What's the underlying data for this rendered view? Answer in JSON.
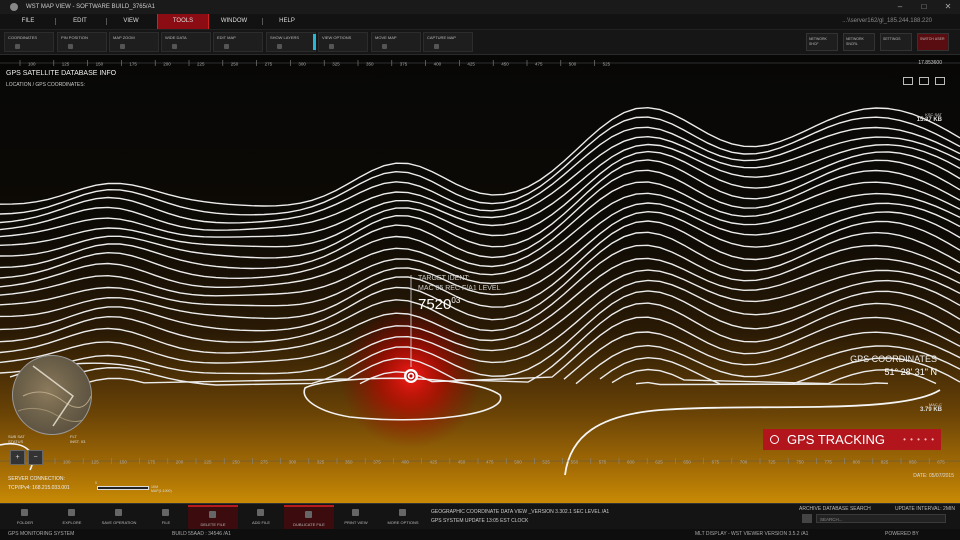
{
  "window": {
    "title": "WST MAP VIEW - SOFTWARE BUILD_3765/A1",
    "controls": [
      "–",
      "□",
      "✕"
    ]
  },
  "menu": {
    "items": [
      "FILE",
      "EDIT",
      "VIEW",
      "TOOLS",
      "WINDOW",
      "HELP"
    ],
    "active": "TOOLS",
    "ip": "...\\\\server162/gl_185.244.188.220"
  },
  "toolbar": {
    "buttons": [
      "COORDINATES",
      "PIN POSITION",
      "MAP ZOOM",
      "WIDE DATA",
      "EDIT MAP",
      "SHOW LAYERS",
      "VIEW OPTIONS",
      "MOVE MAP",
      "CAPTURE MAP"
    ],
    "right_buttons": [
      "NETWORK SHCF",
      "NETWORK SNCRL",
      "SETTINGS",
      "SWITCH USER"
    ]
  },
  "map": {
    "panel_title": "GPS SATELLITE DATABASE INFO",
    "panel_subtitle": "LOCATION / GPS COORDINATES:",
    "ruler_top": [
      "100",
      "125",
      "150",
      "175",
      "200",
      "225",
      "250",
      "275",
      "300",
      "325",
      "350",
      "375",
      "400",
      "425",
      "450",
      "475",
      "500",
      "525"
    ],
    "ruler_bottom": [
      "100",
      "125",
      "150",
      "175",
      "200",
      "225",
      "250",
      "275",
      "300",
      "325",
      "350",
      "375",
      "400",
      "425",
      "450",
      "475",
      "500",
      "525",
      "550",
      "575",
      "600",
      "625",
      "650",
      "675",
      "700",
      "725",
      "750",
      "775",
      "800",
      "825",
      "850",
      "875"
    ],
    "sat_readout": "17.853600",
    "ksc": {
      "label": "KSC SAT",
      "value": "15.37 KB"
    },
    "mac": {
      "label": "MAC-C",
      "value": "3.79 KB"
    },
    "target": {
      "line1": "TARGET IDENT:",
      "line2": "MAC 05 REC F/A1 LEVEL",
      "value": "7520",
      "value_sup": "03"
    },
    "gps_coordinates_label": "GPS COORDINATES",
    "gps_coordinates_value": "51° 28' 31\" N",
    "tracking_label": "GPS TRACKING",
    "tracking_dots": "• • • • •",
    "date": "DATE: 05/07/2015",
    "server_label": "SERVER CONNECTION:",
    "server_value": "TCP/IPv4: 168.215.033.001",
    "scale_label": "1KM MAP(1:1000)",
    "scale_left": "0",
    "flt_left": "SUB SAT\nSTATUS",
    "flt_right": "FLT\nINST. 03",
    "zoom_in": "+",
    "zoom_out": "−"
  },
  "bottom": {
    "buttons": [
      "FOLDER",
      "EXPLORE",
      "SAVE OPERATION",
      "FILE",
      "DELETE FILE",
      "ADD FILE",
      "DUBLICATE FILE",
      "PRINT VIEW",
      "MORE OPTIONS"
    ],
    "red_buttons": [
      "DELETE FILE",
      "DUBLICATE FILE"
    ],
    "geo1": "GEOGRAPHIC COORDINATE DATA VIEW _VERSION 3.302.1 SEC LEVEL /A1",
    "geo2": "GPS SYSTEM UPDATE 13:05 EST CLOCK",
    "archive": "ARCHIVE DATABASE SEARCH",
    "interval": "UPDATE INTERVAL: 2MIN",
    "search_placeholder": "SEARCH..."
  },
  "status": {
    "left": "GPS MONITORING SYSTEM",
    "build": "BUILD 55AAD : 34546 /A1",
    "display": "MLT DISPLAY - WST VIEWER VERSION 3.5.2 /A1",
    "powered": "POWERED BY"
  },
  "colors": {
    "accent_red": "#b2151b",
    "accent_cyan": "#25b7d6",
    "map_amber": "#c88a05"
  }
}
